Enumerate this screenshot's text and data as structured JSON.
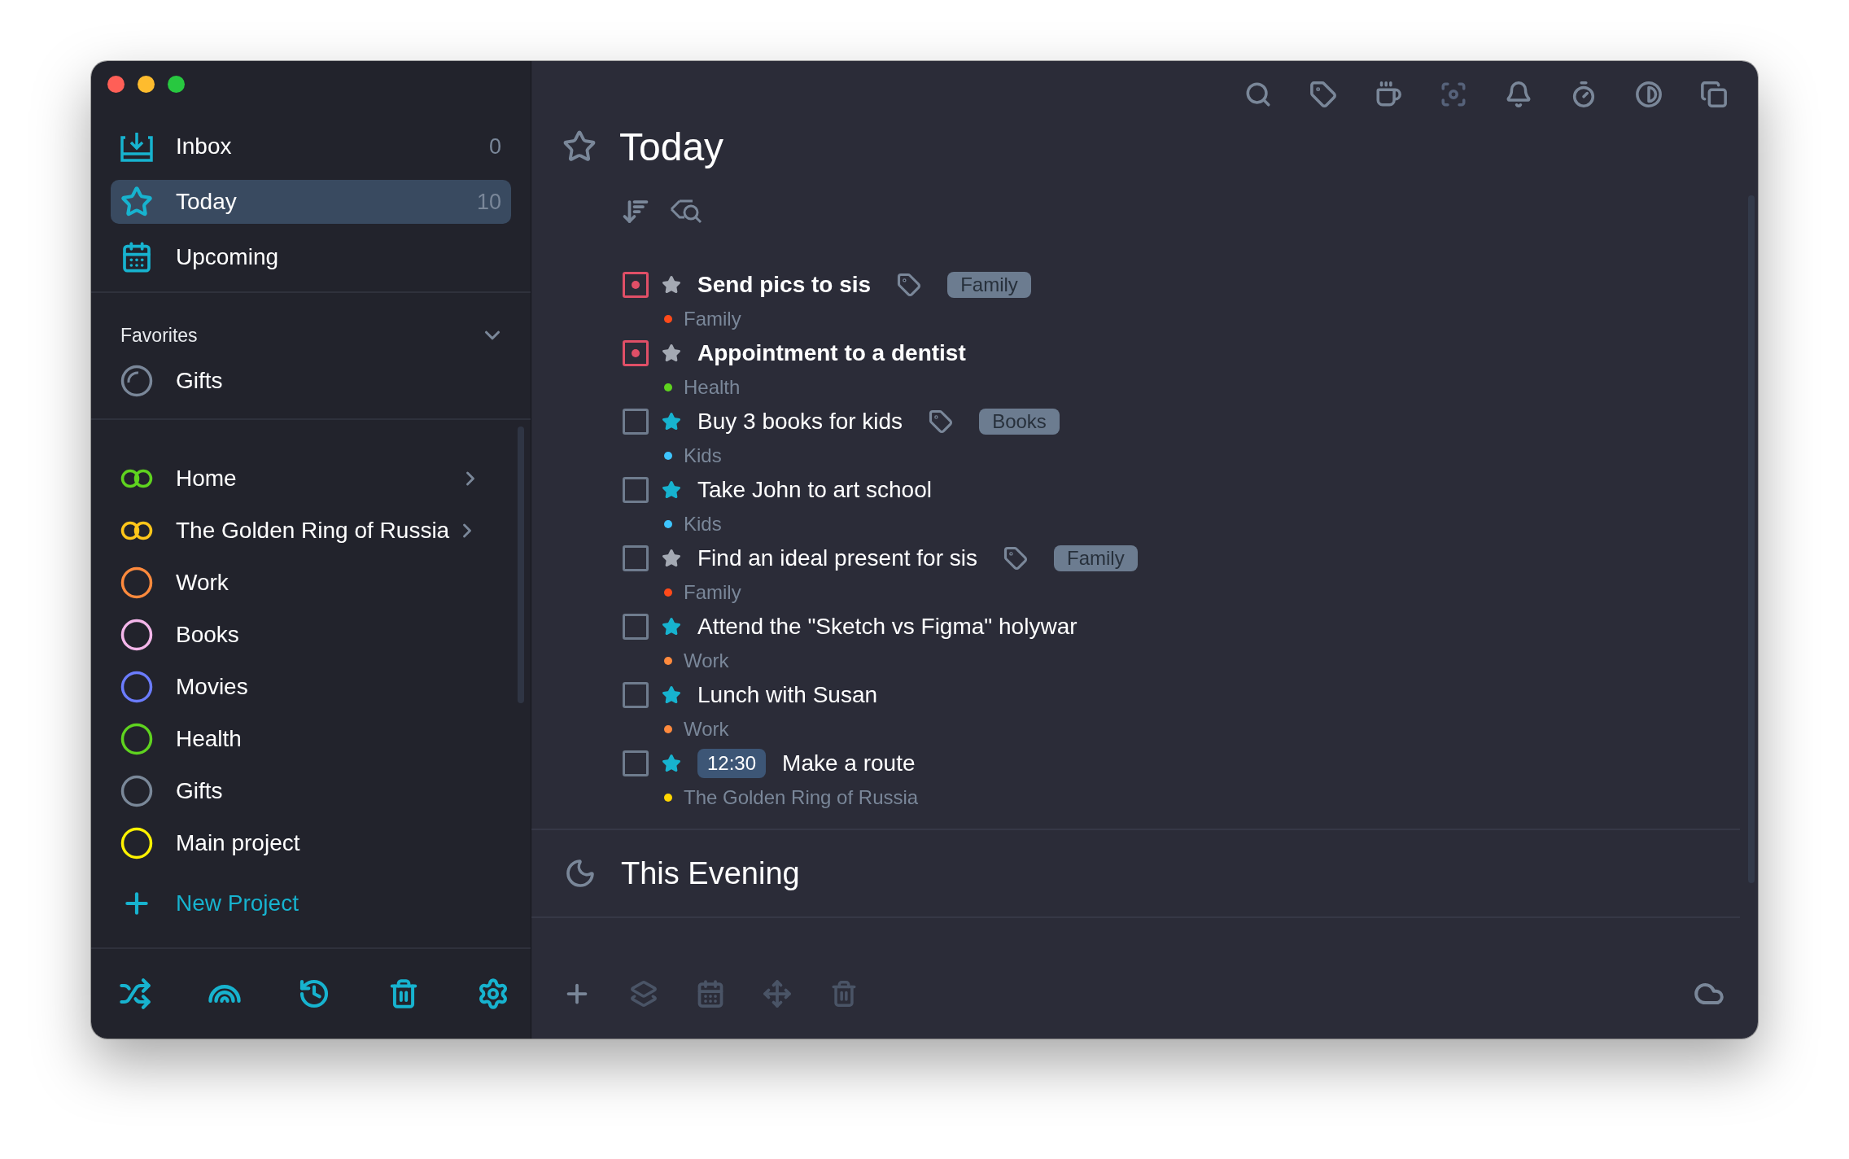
{
  "sidebar": {
    "nav": [
      {
        "kind": "inbox",
        "label": "Inbox",
        "count": "0",
        "selected": false
      },
      {
        "kind": "today",
        "label": "Today",
        "count": "10",
        "selected": true
      },
      {
        "kind": "upcoming",
        "label": "Upcoming",
        "selected": false
      }
    ],
    "favorites": {
      "title": "Favorites",
      "expanded": true,
      "items": [
        {
          "label": "Gifts"
        }
      ]
    },
    "projects": [
      {
        "kind": "group",
        "label": "Home",
        "color": "#5fd31f"
      },
      {
        "kind": "group",
        "label": "The Golden Ring of Russia",
        "color": "#ffc61a"
      },
      {
        "kind": "project",
        "label": "Work",
        "color": "#ff8a3d"
      },
      {
        "kind": "project",
        "label": "Books",
        "color": "#f4b6ea"
      },
      {
        "kind": "project",
        "label": "Movies",
        "color": "#6b7cff"
      },
      {
        "kind": "project",
        "label": "Health",
        "color": "#5fd31f"
      },
      {
        "kind": "project",
        "label": "Gifts",
        "color": "#7a8899"
      },
      {
        "kind": "project",
        "label": "Main project",
        "color": "#fff200"
      }
    ],
    "new_project": "New Project"
  },
  "main": {
    "title": "Today",
    "tasks": [
      {
        "title": "Send pics to sis",
        "overdue": true,
        "starred": false,
        "tag": "Family",
        "project": "Family",
        "color": "#ff4a1a"
      },
      {
        "title": "Appointment to a dentist",
        "overdue": true,
        "starred": false,
        "project": "Health",
        "color": "#5fd31f"
      },
      {
        "title": "Buy 3 books for kids",
        "overdue": false,
        "starred": true,
        "tag": "Books",
        "project": "Kids",
        "color": "#3ec5ff"
      },
      {
        "title": "Take John to art school",
        "overdue": false,
        "starred": true,
        "project": "Kids",
        "color": "#3ec5ff"
      },
      {
        "title": "Find an ideal present for sis",
        "overdue": false,
        "starred": false,
        "tag": "Family",
        "project": "Family",
        "color": "#ff4a1a"
      },
      {
        "title": "Attend the \"Sketch vs Figma\" holywar",
        "overdue": false,
        "starred": true,
        "project": "Work",
        "color": "#ff8a3d"
      },
      {
        "title": "Lunch with Susan",
        "overdue": false,
        "starred": true,
        "project": "Work",
        "color": "#ff8a3d"
      },
      {
        "title": "Make a route",
        "overdue": false,
        "starred": true,
        "time": "12:30",
        "project": "The Golden Ring of Russia",
        "color": "#ffd600"
      }
    ],
    "section": "This Evening"
  }
}
